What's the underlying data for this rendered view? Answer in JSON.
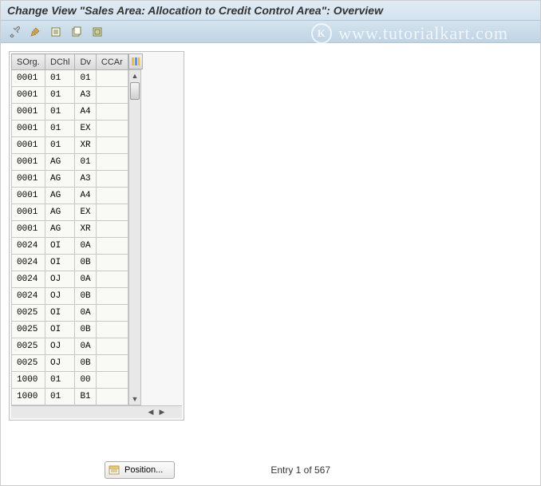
{
  "title": "Change View \"Sales Area: Allocation to Credit Control Area\": Overview",
  "watermark": "www.tutorialkart.com",
  "toolbar": {
    "icons": [
      "tools-icon",
      "pencil-icon",
      "new-entries-icon",
      "copy-icon",
      "select-all-icon"
    ]
  },
  "table": {
    "headers": {
      "sorg": "SOrg.",
      "dchl": "DChl",
      "dv": "Dv",
      "ccar": "CCAr"
    },
    "rows": [
      {
        "sorg": "0001",
        "dchl": "01",
        "dv": "01",
        "ccar": ""
      },
      {
        "sorg": "0001",
        "dchl": "01",
        "dv": "A3",
        "ccar": ""
      },
      {
        "sorg": "0001",
        "dchl": "01",
        "dv": "A4",
        "ccar": ""
      },
      {
        "sorg": "0001",
        "dchl": "01",
        "dv": "EX",
        "ccar": ""
      },
      {
        "sorg": "0001",
        "dchl": "01",
        "dv": "XR",
        "ccar": ""
      },
      {
        "sorg": "0001",
        "dchl": "AG",
        "dv": "01",
        "ccar": ""
      },
      {
        "sorg": "0001",
        "dchl": "AG",
        "dv": "A3",
        "ccar": ""
      },
      {
        "sorg": "0001",
        "dchl": "AG",
        "dv": "A4",
        "ccar": ""
      },
      {
        "sorg": "0001",
        "dchl": "AG",
        "dv": "EX",
        "ccar": ""
      },
      {
        "sorg": "0001",
        "dchl": "AG",
        "dv": "XR",
        "ccar": ""
      },
      {
        "sorg": "0024",
        "dchl": "OI",
        "dv": "0A",
        "ccar": ""
      },
      {
        "sorg": "0024",
        "dchl": "OI",
        "dv": "0B",
        "ccar": ""
      },
      {
        "sorg": "0024",
        "dchl": "OJ",
        "dv": "0A",
        "ccar": ""
      },
      {
        "sorg": "0024",
        "dchl": "OJ",
        "dv": "0B",
        "ccar": ""
      },
      {
        "sorg": "0025",
        "dchl": "OI",
        "dv": "0A",
        "ccar": ""
      },
      {
        "sorg": "0025",
        "dchl": "OI",
        "dv": "0B",
        "ccar": ""
      },
      {
        "sorg": "0025",
        "dchl": "OJ",
        "dv": "0A",
        "ccar": ""
      },
      {
        "sorg": "0025",
        "dchl": "OJ",
        "dv": "0B",
        "ccar": ""
      },
      {
        "sorg": "1000",
        "dchl": "01",
        "dv": "00",
        "ccar": ""
      },
      {
        "sorg": "1000",
        "dchl": "01",
        "dv": "B1",
        "ccar": ""
      }
    ]
  },
  "footer": {
    "position_label": "Position...",
    "entry_text": "Entry 1 of 567"
  }
}
